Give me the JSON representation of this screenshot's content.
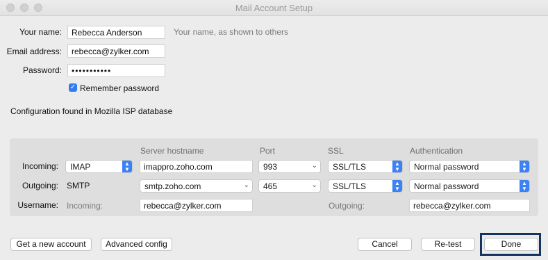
{
  "window": {
    "title": "Mail Account Setup"
  },
  "form": {
    "name_label": "Your name:",
    "name_value": "Rebecca Anderson",
    "name_hint": "Your name, as shown to others",
    "email_label": "Email address:",
    "email_value": "rebecca@zylker.com",
    "password_label": "Password:",
    "password_value": "•••••••••••",
    "remember_label": "Remember password",
    "remember_checked": true,
    "config_status": "Configuration found in Mozilla ISP database"
  },
  "server": {
    "headers": {
      "hostname": "Server hostname",
      "port": "Port",
      "ssl": "SSL",
      "auth": "Authentication"
    },
    "incoming": {
      "label": "Incoming:",
      "protocol": "IMAP",
      "hostname": "imappro.zoho.com",
      "port": "993",
      "ssl": "SSL/TLS",
      "auth": "Normal password"
    },
    "outgoing": {
      "label": "Outgoing:",
      "protocol": "SMTP",
      "hostname": "smtp.zoho.com",
      "port": "465",
      "ssl": "SSL/TLS",
      "auth": "Normal password"
    },
    "username": {
      "label": "Username:",
      "incoming_label": "Incoming:",
      "incoming_value": "rebecca@zylker.com",
      "outgoing_label": "Outgoing:",
      "outgoing_value": "rebecca@zylker.com"
    }
  },
  "buttons": {
    "new_account": "Get a new account",
    "advanced": "Advanced config",
    "cancel": "Cancel",
    "retest": "Re-test",
    "done": "Done"
  },
  "icons": {
    "select_stepper": "updown-chevron-icon",
    "combo_arrow": "chevron-down-icon",
    "check": "checkmark-icon"
  },
  "colors": {
    "accent": "#3b82f6",
    "checkbox": "#2f7cf6",
    "done_highlight": "#13355f"
  }
}
